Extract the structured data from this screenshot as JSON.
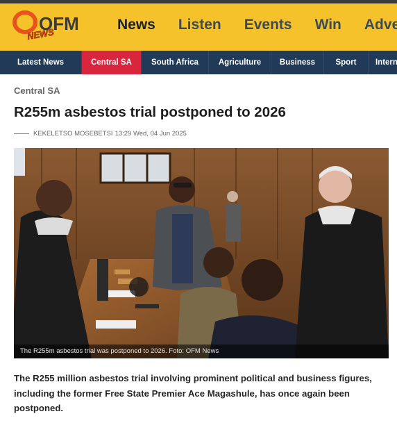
{
  "brand": {
    "logo_letters": "OFM",
    "logo_sub": "NEWS",
    "colors": {
      "header_bg": "#f5c22b",
      "subnav_bg": "#213a57",
      "active_tab": "#d7263d",
      "logo_orange": "#e8531d"
    }
  },
  "main_nav": [
    "News",
    "Listen",
    "Events",
    "Win",
    "Advertise"
  ],
  "sub_nav": [
    "Latest News",
    "Central SA",
    "South Africa",
    "Agriculture",
    "Business",
    "Sport",
    "International"
  ],
  "article": {
    "category": "Central SA",
    "title": "R255m asbestos trial postponed to 2026",
    "author": "KEKELETSO MOSEBETSI",
    "time": "13:29 Wed, 04 Jun 2025",
    "image_caption": "The R255m asbestos trial was postponed to 2026. Foto: OFM News",
    "lead": "The R255 million asbestos trial involving prominent political and business figures, including the former Free State Premier Ace Magashule, has once again been postponed."
  }
}
